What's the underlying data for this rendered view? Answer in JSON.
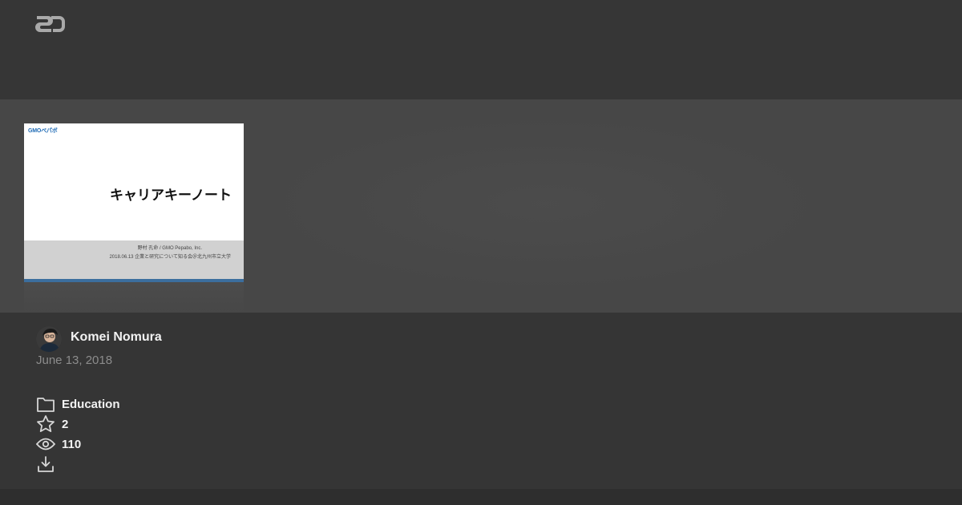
{
  "site": {
    "logo_icon": "speakerdeck-logo-icon"
  },
  "slide": {
    "brand": "GMOペパボ",
    "title": "キャリアキーノート",
    "author_line": "野村 孔命 / GMO Pepabo, Inc.",
    "event_line": "2018.06.13 企業と研究について知る会＠北九州市立大学"
  },
  "author": {
    "name": "Komei Nomura",
    "avatar_icon": "avatar"
  },
  "date": "June 13, 2018",
  "meta": {
    "category": "Education",
    "stars": "2",
    "views": "110",
    "category_icon": "folder-icon",
    "stars_icon": "star-icon",
    "views_icon": "eye-icon",
    "download_icon": "download-icon"
  },
  "colors": {
    "background": "#353535",
    "stage": "#474747",
    "text_primary": "#f2f2f2",
    "text_muted": "#8c8c8c",
    "slide_brand": "#1f6bb5",
    "slide_bar": "#3b6e9e"
  }
}
